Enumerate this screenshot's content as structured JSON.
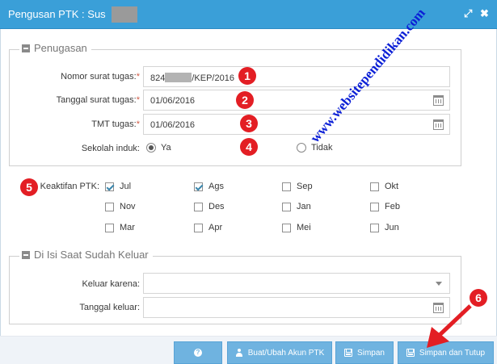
{
  "window": {
    "title": "Pengusan PTK : Sus",
    "icons": {
      "maximize": "resize-arrows-icon",
      "close": "close-icon"
    }
  },
  "penugasan": {
    "legend": "Penugasan",
    "nomor_label": "Nomor surat tugas:",
    "nomor_value_prefix": "824",
    "nomor_value_suffix": "/KEP/2016",
    "tanggal_label": "Tanggal surat tugas:",
    "tanggal_value": "01/06/2016",
    "tmt_label": "TMT tugas:",
    "tmt_value": "01/06/2016",
    "sekolah_label": "Sekolah induk:",
    "sekolah_options": [
      "Ya",
      "Tidak"
    ],
    "sekolah_selected": "Ya",
    "required_mark": "*"
  },
  "keaktifan": {
    "label": "Keaktifan PTK:",
    "months": [
      {
        "name": "Jul",
        "checked": true
      },
      {
        "name": "Ags",
        "checked": true
      },
      {
        "name": "Sep",
        "checked": false
      },
      {
        "name": "Okt",
        "checked": false
      },
      {
        "name": "Nov",
        "checked": false
      },
      {
        "name": "Des",
        "checked": false
      },
      {
        "name": "Jan",
        "checked": false
      },
      {
        "name": "Feb",
        "checked": false
      },
      {
        "name": "Mar",
        "checked": false
      },
      {
        "name": "Apr",
        "checked": false
      },
      {
        "name": "Mei",
        "checked": false
      },
      {
        "name": "Jun",
        "checked": false
      }
    ]
  },
  "keluar": {
    "legend": "Di Isi Saat Sudah Keluar",
    "karena_label": "Keluar karena:",
    "karena_value": "",
    "tanggal_label": "Tanggal keluar:",
    "tanggal_value": ""
  },
  "footer": {
    "help_label": "?",
    "akun_label": "Buat/Ubah Akun PTK",
    "simpan_label": "Simpan",
    "simpan_tutup_label": "Simpan dan Tutup"
  },
  "annotations": [
    "1",
    "2",
    "3",
    "4",
    "5",
    "6"
  ],
  "watermark": "www.websitependidikan.com",
  "colors": {
    "titlebar": "#3a9fd8",
    "button": "#6fb3e0",
    "marker": "#e31e24",
    "watermark": "#0b1fd6"
  }
}
